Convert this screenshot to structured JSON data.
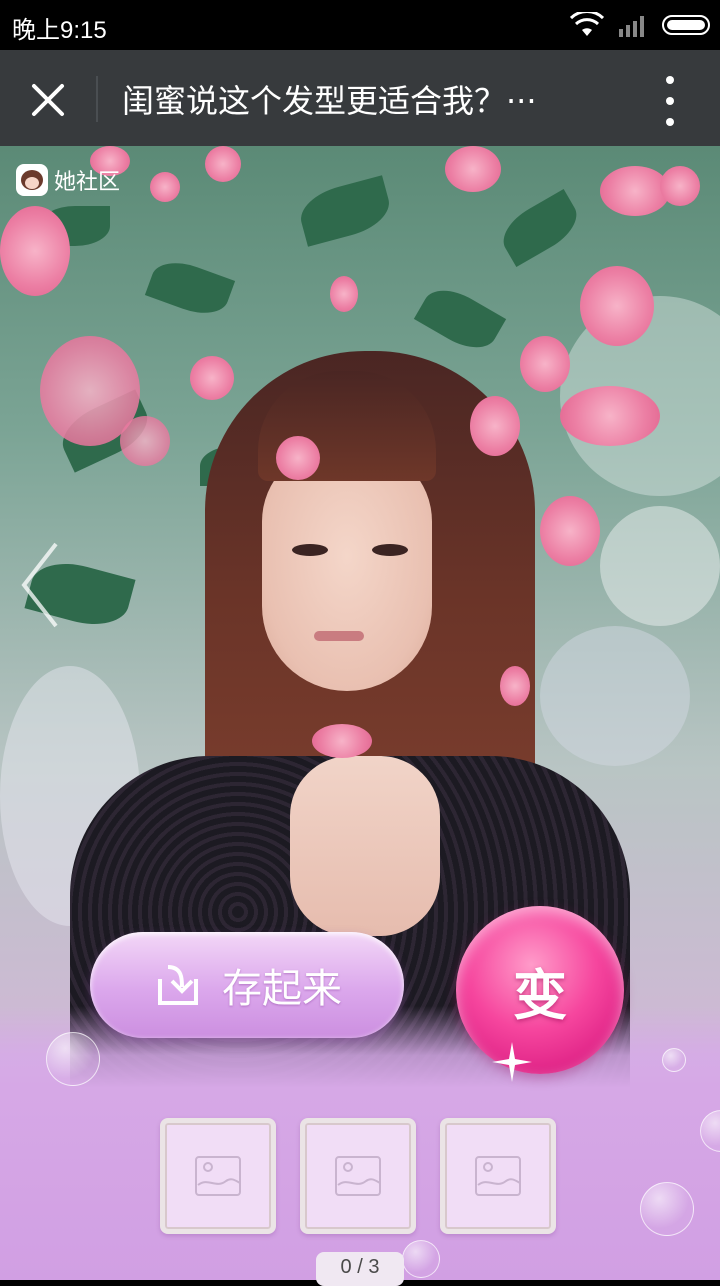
{
  "status_bar": {
    "time": "晚上9:15",
    "icons": [
      "wifi-icon",
      "signal-icon",
      "battery-icon"
    ]
  },
  "nav": {
    "title": "闺蜜说这个发型更适合我？···",
    "close_icon": "close-icon",
    "more_icon": "more-vertical-icon"
  },
  "watermark": {
    "text": "她社区"
  },
  "actions": {
    "save_label": "存起来",
    "transform_label": "变"
  },
  "thumbnails": [
    {
      "icon": "image-placeholder-icon"
    },
    {
      "icon": "image-placeholder-icon"
    },
    {
      "icon": "image-placeholder-icon"
    }
  ],
  "pager": {
    "text": "0 / 3"
  },
  "colors": {
    "status_bg": "#000000",
    "nav_bg": "#373a3d",
    "panel_purple": "#d6a8e6",
    "transform_pink": "#e8288a"
  }
}
